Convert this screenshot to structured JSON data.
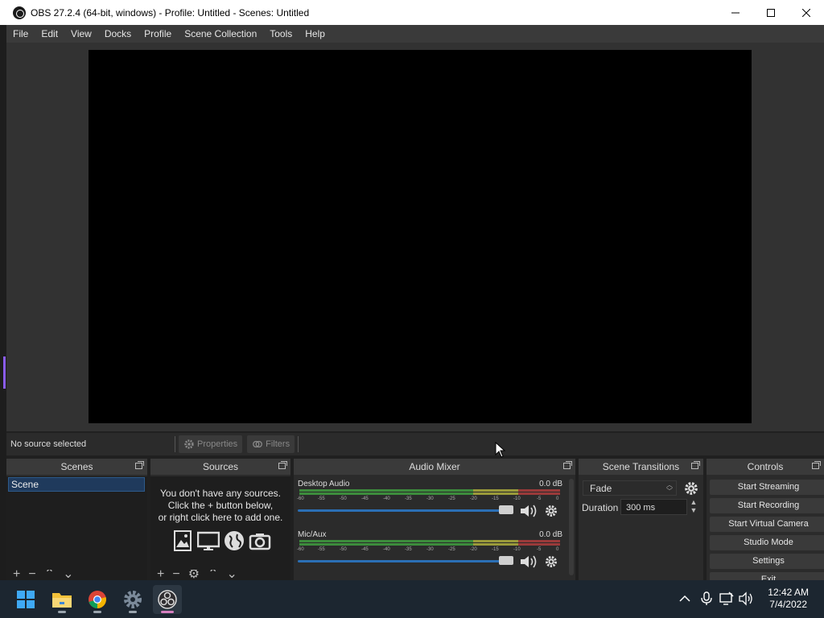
{
  "window": {
    "title": "OBS 27.2.4 (64-bit, windows) - Profile: Untitled - Scenes: Untitled",
    "minimize": "—",
    "maximize": "☐",
    "close": "✕"
  },
  "menu": [
    "File",
    "Edit",
    "View",
    "Docks",
    "Profile",
    "Scene Collection",
    "Tools",
    "Help"
  ],
  "source_toolbar": {
    "status": "No source selected",
    "properties": "Properties",
    "filters": "Filters"
  },
  "docks": {
    "scenes": {
      "title": "Scenes",
      "items": [
        "Scene"
      ]
    },
    "sources": {
      "title": "Sources",
      "empty_line1": "You don't have any sources.",
      "empty_line2": "Click the + button below,",
      "empty_line3": "or right click here to add one."
    },
    "mixer": {
      "title": "Audio Mixer",
      "channels": [
        {
          "name": "Desktop Audio",
          "db": "0.0 dB",
          "volume_fraction": 1.0
        },
        {
          "name": "Mic/Aux",
          "db": "0.0 dB",
          "volume_fraction": 1.0
        }
      ],
      "ticks": [
        "-60",
        "-55",
        "-50",
        "-45",
        "-40",
        "-35",
        "-30",
        "-25",
        "-20",
        "-15",
        "-10",
        "-5",
        "0"
      ]
    },
    "transitions": {
      "title": "Scene Transitions",
      "selected": "Fade",
      "duration_label": "Duration",
      "duration_value": "300 ms"
    },
    "controls": {
      "title": "Controls",
      "buttons": [
        "Start Streaming",
        "Start Recording",
        "Start Virtual Camera",
        "Studio Mode",
        "Settings",
        "Exit"
      ]
    }
  },
  "taskbar": {
    "apps": [
      "start-icon",
      "file-explorer-icon",
      "chrome-icon",
      "settings-icon",
      "obs-icon"
    ],
    "time": "12:42 AM",
    "date": "7/4/2022"
  },
  "colors": {
    "accent": "#2b6fb5",
    "meter_green": "#3c8c3c",
    "meter_yellow": "#9a9a3a",
    "meter_red": "#9a3a3a",
    "obs_indicator": "#d57fbf"
  }
}
